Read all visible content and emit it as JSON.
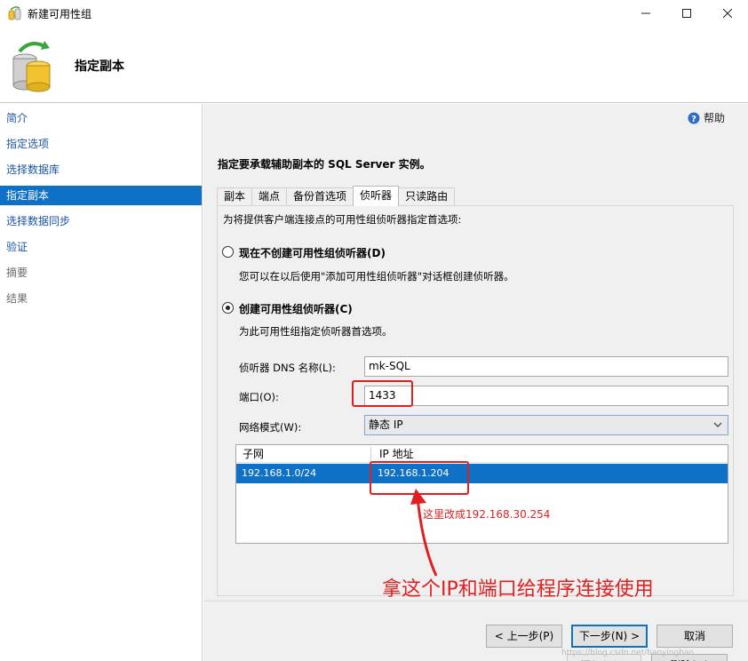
{
  "window": {
    "title": "新建可用性组",
    "icons": {
      "app": "availability-group-icon",
      "minimize": "minimize-icon",
      "maximize": "maximize-icon",
      "close": "close-icon"
    }
  },
  "header": {
    "title": "指定副本",
    "icon": "database-refresh-icon"
  },
  "sidebar": {
    "items": [
      {
        "label": "简介",
        "state": "link"
      },
      {
        "label": "指定选项",
        "state": "link"
      },
      {
        "label": "选择数据库",
        "state": "link"
      },
      {
        "label": "指定副本",
        "state": "selected"
      },
      {
        "label": "选择数据同步",
        "state": "link"
      },
      {
        "label": "验证",
        "state": "link"
      },
      {
        "label": "摘要",
        "state": "disabled"
      },
      {
        "label": "结果",
        "state": "disabled"
      }
    ]
  },
  "main": {
    "help_label": "帮助",
    "help_icon": "help-icon",
    "instruction": "指定要承载辅助副本的 SQL Server 实例。",
    "tabs": [
      {
        "label": "副本",
        "active": false
      },
      {
        "label": "端点",
        "active": false
      },
      {
        "label": "备份首选项",
        "active": false
      },
      {
        "label": "侦听器",
        "active": true
      },
      {
        "label": "只读路由",
        "active": false
      }
    ],
    "listener": {
      "intro": "为将提供客户端连接点的可用性组侦听器指定首选项:",
      "option_no": {
        "label": "现在不创建可用性组侦听器(D)",
        "checked": false,
        "desc": "您可以在以后使用\"添加可用性组侦听器\"对话框创建侦听器。"
      },
      "option_yes": {
        "label": "创建可用性组侦听器(C)",
        "checked": true,
        "desc": "为此可用性组指定侦听器首选项。"
      },
      "dns_label": "侦听器 DNS 名称(L):",
      "dns_value": "mk-SQL",
      "port_label": "端口(O):",
      "port_value": "1433",
      "network_label": "网络模式(W):",
      "network_value": "静态 IP",
      "grid": {
        "columns": [
          "子网",
          "IP 地址"
        ],
        "rows": [
          [
            "192.168.1.0/24",
            "192.168.1.204"
          ]
        ]
      },
      "add_button": "添加(A)...",
      "remove_button": "删除(M)"
    }
  },
  "annotations": {
    "note_ip": "这里改成192.168.30.254",
    "note_main": "拿这个IP和端口给程序连接使用",
    "color": "#e02020"
  },
  "footer": {
    "prev_button": "< 上一步(P)",
    "next_button": "下一步(N) >",
    "cancel_button": "取消"
  },
  "watermark": "https://blog.csdn.net/baoyingbao"
}
